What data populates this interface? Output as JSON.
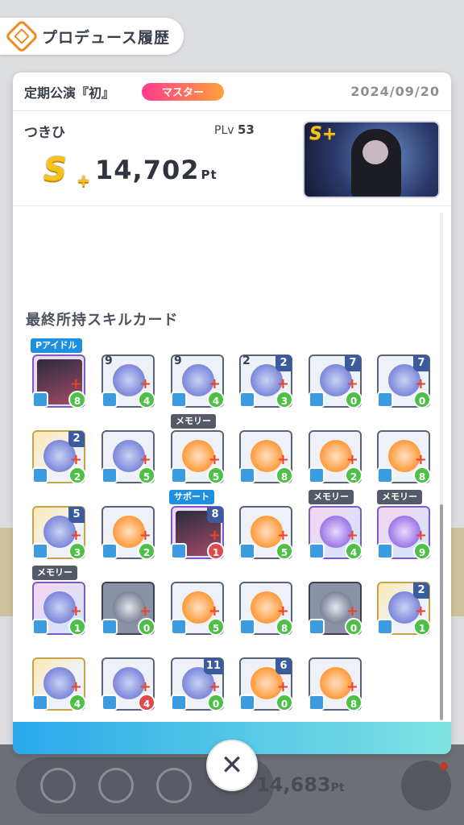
{
  "header": {
    "title": "プロデュース履歴",
    "logo_icon": "produce-logo-icon"
  },
  "record": {
    "event_name": "定期公演『初』",
    "difficulty": "マスター",
    "date": "2024/09/20",
    "idol_name": "つきひ",
    "plv_label": "PLv",
    "plv_value": "53",
    "rank": "S+",
    "score": "14,702",
    "score_unit": "Pt"
  },
  "skill_cards": {
    "section_title": "最終所持スキルカード",
    "tags": {
      "p_idol": "Pアイドル",
      "memory": "メモリー",
      "support": "サポート"
    },
    "cards": [
      {
        "row": 0,
        "col": 0,
        "style": "ssr",
        "art": "pic",
        "tag": "Pアイドル",
        "cost": "8",
        "cost_color": "green"
      },
      {
        "row": 0,
        "col": 1,
        "style": "normal",
        "art": "blue",
        "num_left": "9",
        "cost": "4",
        "cost_color": "green"
      },
      {
        "row": 0,
        "col": 2,
        "style": "normal",
        "art": "blue",
        "num_left": "9",
        "cost": "4",
        "cost_color": "green"
      },
      {
        "row": 0,
        "col": 3,
        "style": "normal",
        "art": "blue",
        "num_left": "2",
        "num": "2",
        "cost": "3",
        "cost_color": "green"
      },
      {
        "row": 0,
        "col": 4,
        "style": "normal",
        "art": "blue",
        "num": "7",
        "cost": "0",
        "cost_color": "green"
      },
      {
        "row": 0,
        "col": 5,
        "style": "normal",
        "art": "blue",
        "num": "7",
        "cost": "0",
        "cost_color": "green"
      },
      {
        "row": 1,
        "col": 0,
        "style": "rare",
        "art": "blue",
        "num": "2",
        "cost": "2",
        "cost_color": "green"
      },
      {
        "row": 1,
        "col": 1,
        "style": "normal",
        "art": "blue",
        "cost": "5",
        "cost_color": "green"
      },
      {
        "row": 1,
        "col": 2,
        "style": "normal",
        "art": "orange",
        "tag": "メモリー",
        "cost": "5",
        "cost_color": "green"
      },
      {
        "row": 1,
        "col": 3,
        "style": "normal",
        "art": "orange",
        "cost": "8",
        "cost_color": "green"
      },
      {
        "row": 1,
        "col": 4,
        "style": "normal",
        "art": "orange",
        "cost": "2",
        "cost_color": "green"
      },
      {
        "row": 1,
        "col": 5,
        "style": "normal",
        "art": "orange",
        "cost": "8",
        "cost_color": "green"
      },
      {
        "row": 2,
        "col": 0,
        "style": "rare",
        "art": "blue",
        "num": "5",
        "cost": "3",
        "cost_color": "green"
      },
      {
        "row": 2,
        "col": 1,
        "style": "normal",
        "art": "orange",
        "cost": "2",
        "cost_color": "green"
      },
      {
        "row": 2,
        "col": 2,
        "style": "ssr",
        "art": "pic",
        "tag": "サポート",
        "num": "8",
        "cost": "1",
        "cost_color": "red"
      },
      {
        "row": 2,
        "col": 3,
        "style": "normal",
        "art": "orange",
        "cost": "5",
        "cost_color": "green"
      },
      {
        "row": 2,
        "col": 4,
        "style": "ssr",
        "art": "purple",
        "tag": "メモリー",
        "cost": "4",
        "cost_color": "green"
      },
      {
        "row": 2,
        "col": 5,
        "style": "ssr",
        "art": "purple",
        "tag": "メモリー",
        "cost": "9",
        "cost_color": "green"
      },
      {
        "row": 3,
        "col": 0,
        "style": "ssr",
        "art": "blue",
        "tag": "メモリー",
        "cost": "1",
        "cost_color": "green"
      },
      {
        "row": 3,
        "col": 1,
        "style": "dark",
        "art": "grey",
        "cost": "0",
        "cost_color": "green"
      },
      {
        "row": 3,
        "col": 2,
        "style": "normal",
        "art": "orange",
        "cost": "5",
        "cost_color": "green"
      },
      {
        "row": 3,
        "col": 3,
        "style": "normal",
        "art": "orange",
        "cost": "8",
        "cost_color": "green"
      },
      {
        "row": 3,
        "col": 4,
        "style": "dark",
        "art": "grey",
        "cost": "0",
        "cost_color": "green"
      },
      {
        "row": 3,
        "col": 5,
        "style": "rare",
        "art": "blue",
        "num": "2",
        "cost": "1",
        "cost_color": "green"
      },
      {
        "row": 4,
        "col": 0,
        "style": "rare",
        "art": "blue",
        "cost": "4",
        "cost_color": "green"
      },
      {
        "row": 4,
        "col": 1,
        "style": "normal",
        "art": "blue",
        "cost": "4",
        "cost_color": "red"
      },
      {
        "row": 4,
        "col": 2,
        "style": "normal",
        "art": "blue",
        "num": "11",
        "cost": "0",
        "cost_color": "green"
      },
      {
        "row": 4,
        "col": 3,
        "style": "normal",
        "art": "orange",
        "num": "6",
        "cost": "0",
        "cost_color": "green"
      },
      {
        "row": 4,
        "col": 4,
        "style": "normal",
        "art": "orange",
        "cost": "8",
        "cost_color": "green"
      }
    ]
  },
  "background": {
    "score_text": "14,683",
    "score_unit": "Pt"
  },
  "close_button": {
    "icon": "close-icon",
    "glyph": "✕"
  },
  "colors": {
    "accent_blue": "#29a9ea",
    "badge_gradient_start": "#ff3a8c",
    "badge_gradient_end": "#ffa23a",
    "rank_gold": "#f6c31c"
  }
}
